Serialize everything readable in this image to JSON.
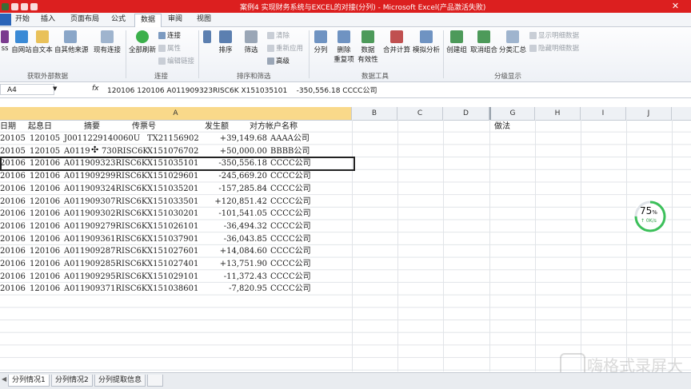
{
  "window": {
    "title": "案例4 实现财务系统与EXCEL的对接(分列) - Microsoft Excel(产品激活失败)",
    "close_glyph": "✕"
  },
  "ribbon_tabs": [
    "开始",
    "插入",
    "页面布局",
    "公式",
    "数据",
    "审阅",
    "视图"
  ],
  "active_tab": "数据",
  "ribbon": {
    "ext_buttons": [
      "ss",
      "自网站",
      "自文本",
      "自其他来源",
      "现有连接"
    ],
    "refresh": "全部刷新",
    "conn_small": [
      "连接",
      "属性",
      "编辑链接"
    ],
    "sort_buttons": [
      "排序",
      "筛选"
    ],
    "filter_small": [
      "清除",
      "重新应用",
      "高级"
    ],
    "tools_buttons": [
      "分列",
      "删除\n重复项",
      "数据\n有效性",
      "合并计算",
      "模拟分析"
    ],
    "outline_buttons": [
      "创建组",
      "取消组合",
      "分类汇总"
    ],
    "outline_small": [
      "显示明细数据",
      "隐藏明细数据"
    ],
    "group_labels": [
      "获取外部数据",
      "连接",
      "排序和筛选",
      "数据工具",
      "分级显示"
    ]
  },
  "formula_bar": {
    "name_box": "A4",
    "fx": "fx",
    "content": "120106 120106 A011909323RISC6K X151035101    -350,556.18 CCCC公司"
  },
  "columns": [
    "A",
    "B",
    "C",
    "D",
    "G",
    "H",
    "I",
    "J"
  ],
  "header_row": {
    "c1": "日期",
    "c2": "起息日",
    "c3": "摘要",
    "c4": "传票号",
    "c5": "发生额",
    "c6": "对方帐户名称",
    "g": "做法"
  },
  "rows": [
    {
      "d": "20105",
      "v": "120105",
      "s": "J0011229140060U",
      "t": "TX21156902",
      "a": "+39,149.68",
      "n": "AAAA公司"
    },
    {
      "d": "20105",
      "v": "120105",
      "s": "A0119",
      "s2": "730RISC6K",
      "t": "X151076702",
      "a": "+50,000.00",
      "n": "BBBB公司"
    },
    {
      "d": "20106",
      "v": "120106",
      "s": "A011909323RISC6K",
      "t": "X151035101",
      "a": "-350,556.18",
      "n": "CCCC公司"
    },
    {
      "d": "20106",
      "v": "120106",
      "s": "A011909299RISC6K",
      "t": "X151029601",
      "a": "-245,669.20",
      "n": "CCCC公司"
    },
    {
      "d": "20106",
      "v": "120106",
      "s": "A011909324RISC6K",
      "t": "X151035201",
      "a": "-157,285.84",
      "n": "CCCC公司"
    },
    {
      "d": "20106",
      "v": "120106",
      "s": "A011909307RISC6K",
      "t": "X151033501",
      "a": "+120,851.42",
      "n": "CCCC公司"
    },
    {
      "d": "20106",
      "v": "120106",
      "s": "A011909302RISC6K",
      "t": "X151030201",
      "a": "-101,541.05",
      "n": "CCCC公司"
    },
    {
      "d": "20106",
      "v": "120106",
      "s": "A011909279RISC6K",
      "t": "X151026101",
      "a": "-36,494.32",
      "n": "CCCC公司"
    },
    {
      "d": "20106",
      "v": "120106",
      "s": "A011909361RISC6K",
      "t": "X151037901",
      "a": "-36,043.85",
      "n": "CCCC公司"
    },
    {
      "d": "20106",
      "v": "120106",
      "s": "A011909287RISC6K",
      "t": "X151027601",
      "a": "+14,084.60",
      "n": "CCCC公司"
    },
    {
      "d": "20106",
      "v": "120106",
      "s": "A011909285RISC6K",
      "t": "X151027401",
      "a": "+13,751.90",
      "n": "CCCC公司"
    },
    {
      "d": "20106",
      "v": "120106",
      "s": "A011909295RISC6K",
      "t": "X151029101",
      "a": "-11,372.43",
      "n": "CCCC公司"
    },
    {
      "d": "20106",
      "v": "120106",
      "s": "A011909371RISC6K",
      "t": "X151038601",
      "a": "-7,820.95",
      "n": "CCCC公司"
    }
  ],
  "badge": {
    "percent": "75",
    "unit": "%",
    "speed": "↑ 0K/s",
    "fraction": 0.75
  },
  "sheet_tabs": [
    "分列情况1",
    "分列情况2",
    "分列提取信息"
  ],
  "watermark": "嗨格式录屏大",
  "colors": {
    "titlebar": "#dc1f1f",
    "selected_header": "#f9d98a",
    "badge": "#3cc05a"
  }
}
